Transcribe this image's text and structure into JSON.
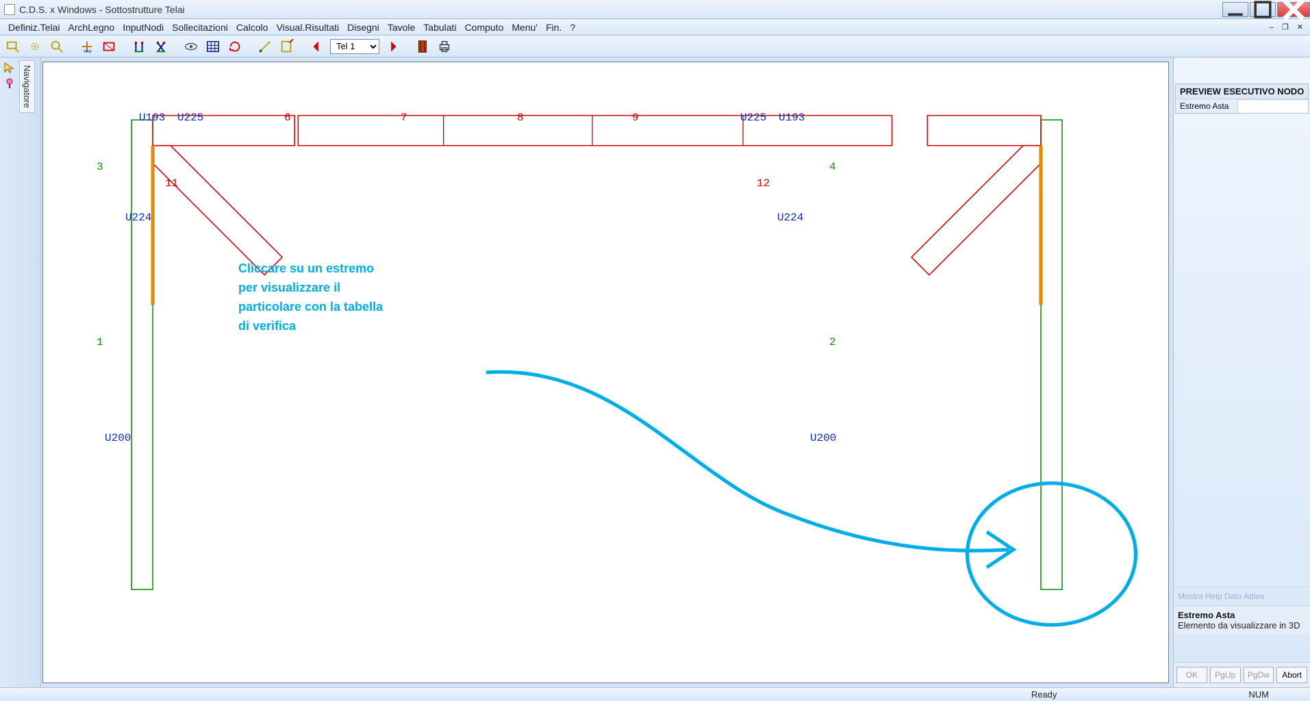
{
  "title": "C.D.S. x Windows - Sottostrutture Telai",
  "menu": [
    "Definiz.Telai",
    "ArchLegno",
    "InputNodi",
    "Sollecitazioni",
    "Calcolo",
    "Visual.Risultati",
    "Disegni",
    "Tavole",
    "Tabulati",
    "Computo",
    "Menu'",
    "Fin.",
    "?"
  ],
  "toolbar": {
    "selector": "Tel 1"
  },
  "navigator_tab": "Navigatore",
  "right": {
    "header": "PREVIEW ESECUTIVO NODO",
    "field_label": "Estremo Asta",
    "help_ghost": "Mostra Help Dato Attivo",
    "info_title": "Estremo Asta",
    "info_desc": "Elemento da visualizzare in 3D",
    "buttons": [
      "OK",
      "PgUp",
      "PgDw",
      "Abort"
    ]
  },
  "status": {
    "ready": "Ready",
    "num": "NUM"
  },
  "canvas": {
    "green_ids": {
      "g1": "1",
      "g2": "2",
      "g3": "3",
      "g4": "4"
    },
    "red": {
      "r6": "6",
      "r7": "7",
      "r8": "8",
      "r9": "9",
      "r11": "11",
      "r12": "12"
    },
    "blue": {
      "u193L": "U193",
      "u225L": "U225",
      "u225R": "U225",
      "u193R": "U193",
      "u224L": "U224",
      "u224R": "U224",
      "u200L": "U200",
      "u200R": "U200"
    },
    "annotation": "Cliccare su un estremo\nper visualizzare il\nparticolare con la tabella\ndi verifica"
  }
}
